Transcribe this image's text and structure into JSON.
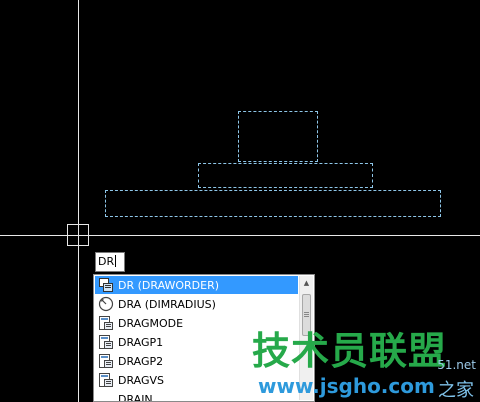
{
  "command_line": {
    "typed_text": "DR"
  },
  "autocomplete": {
    "items": [
      {
        "label": "DR (DRAWORDER)",
        "icon": "draworder-icon",
        "selected": true
      },
      {
        "label": "DRA (DIMRADIUS)",
        "icon": "dimradius-icon",
        "selected": false
      },
      {
        "label": "DRAGMODE",
        "icon": "dragmode-icon",
        "selected": false
      },
      {
        "label": "DRAGP1",
        "icon": "dragp1-icon",
        "selected": false
      },
      {
        "label": "DRAGP2",
        "icon": "dragp2-icon",
        "selected": false
      },
      {
        "label": "DRAGVS",
        "icon": "dragvs-icon",
        "selected": false
      },
      {
        "label": "DRAIN",
        "icon": "",
        "selected": false
      }
    ]
  },
  "watermark": {
    "main_text": "技术员联盟",
    "url_text": "www.jsgho.com",
    "corner_text": "51.net",
    "corner_text2": "之家"
  },
  "colors": {
    "background": "#000000",
    "crosshair": "#e8e8e8",
    "selection_dash": "#8ec6e8",
    "highlight": "#3399ff",
    "watermark_green": "#26a94a",
    "watermark_blue": "#2e9adc"
  }
}
